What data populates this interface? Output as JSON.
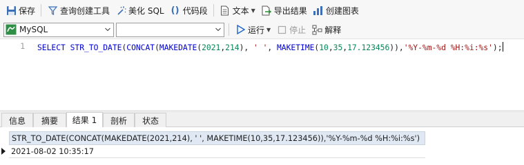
{
  "toolbar": {
    "save": "保存",
    "query_builder": "查询创建工具",
    "beautify": "美化 SQL",
    "snippet": "代码段",
    "text": "文本",
    "export": "导出结果",
    "create_chart": "创建图表"
  },
  "bar2": {
    "connection": "MySQL",
    "database": "",
    "run": "运行",
    "stop": "停止",
    "explain": "解释"
  },
  "editor": {
    "line_number": "1",
    "sql_tokens": [
      {
        "t": "SELECT",
        "c": "kw"
      },
      {
        "t": " ",
        "c": ""
      },
      {
        "t": "STR_TO_DATE",
        "c": "fn"
      },
      {
        "t": "(",
        "c": ""
      },
      {
        "t": "CONCAT",
        "c": "fn"
      },
      {
        "t": "(",
        "c": ""
      },
      {
        "t": "MAKEDATE",
        "c": "fn"
      },
      {
        "t": "(",
        "c": ""
      },
      {
        "t": "2021",
        "c": "num"
      },
      {
        "t": ",",
        "c": ""
      },
      {
        "t": "214",
        "c": "num"
      },
      {
        "t": "), ",
        "c": ""
      },
      {
        "t": "' '",
        "c": "str"
      },
      {
        "t": ", ",
        "c": ""
      },
      {
        "t": "MAKETIME",
        "c": "fn"
      },
      {
        "t": "(",
        "c": ""
      },
      {
        "t": "10",
        "c": "num"
      },
      {
        "t": ",",
        "c": ""
      },
      {
        "t": "35",
        "c": "num"
      },
      {
        "t": ",",
        "c": ""
      },
      {
        "t": "17.123456",
        "c": "num"
      },
      {
        "t": ")),",
        "c": ""
      },
      {
        "t": "'%Y-%m-%d %H:%i:%s'",
        "c": "str"
      },
      {
        "t": ");",
        "c": ""
      }
    ]
  },
  "tabs": [
    "信息",
    "摘要",
    "结果 1",
    "剖析",
    "状态"
  ],
  "result": {
    "column_header": "STR_TO_DATE(CONCAT(MAKEDATE(2021,214), ' ', MAKETIME(10,35,17.123456)),'%Y-%m-%d %H:%i:%s')",
    "value": "2021-08-02 10:35:17"
  },
  "colors": {
    "keyword": "#0000d0",
    "number": "#098658",
    "string": "#a31515",
    "header_bg": "#dfe8f3",
    "run_icon": "#1e64c8"
  }
}
